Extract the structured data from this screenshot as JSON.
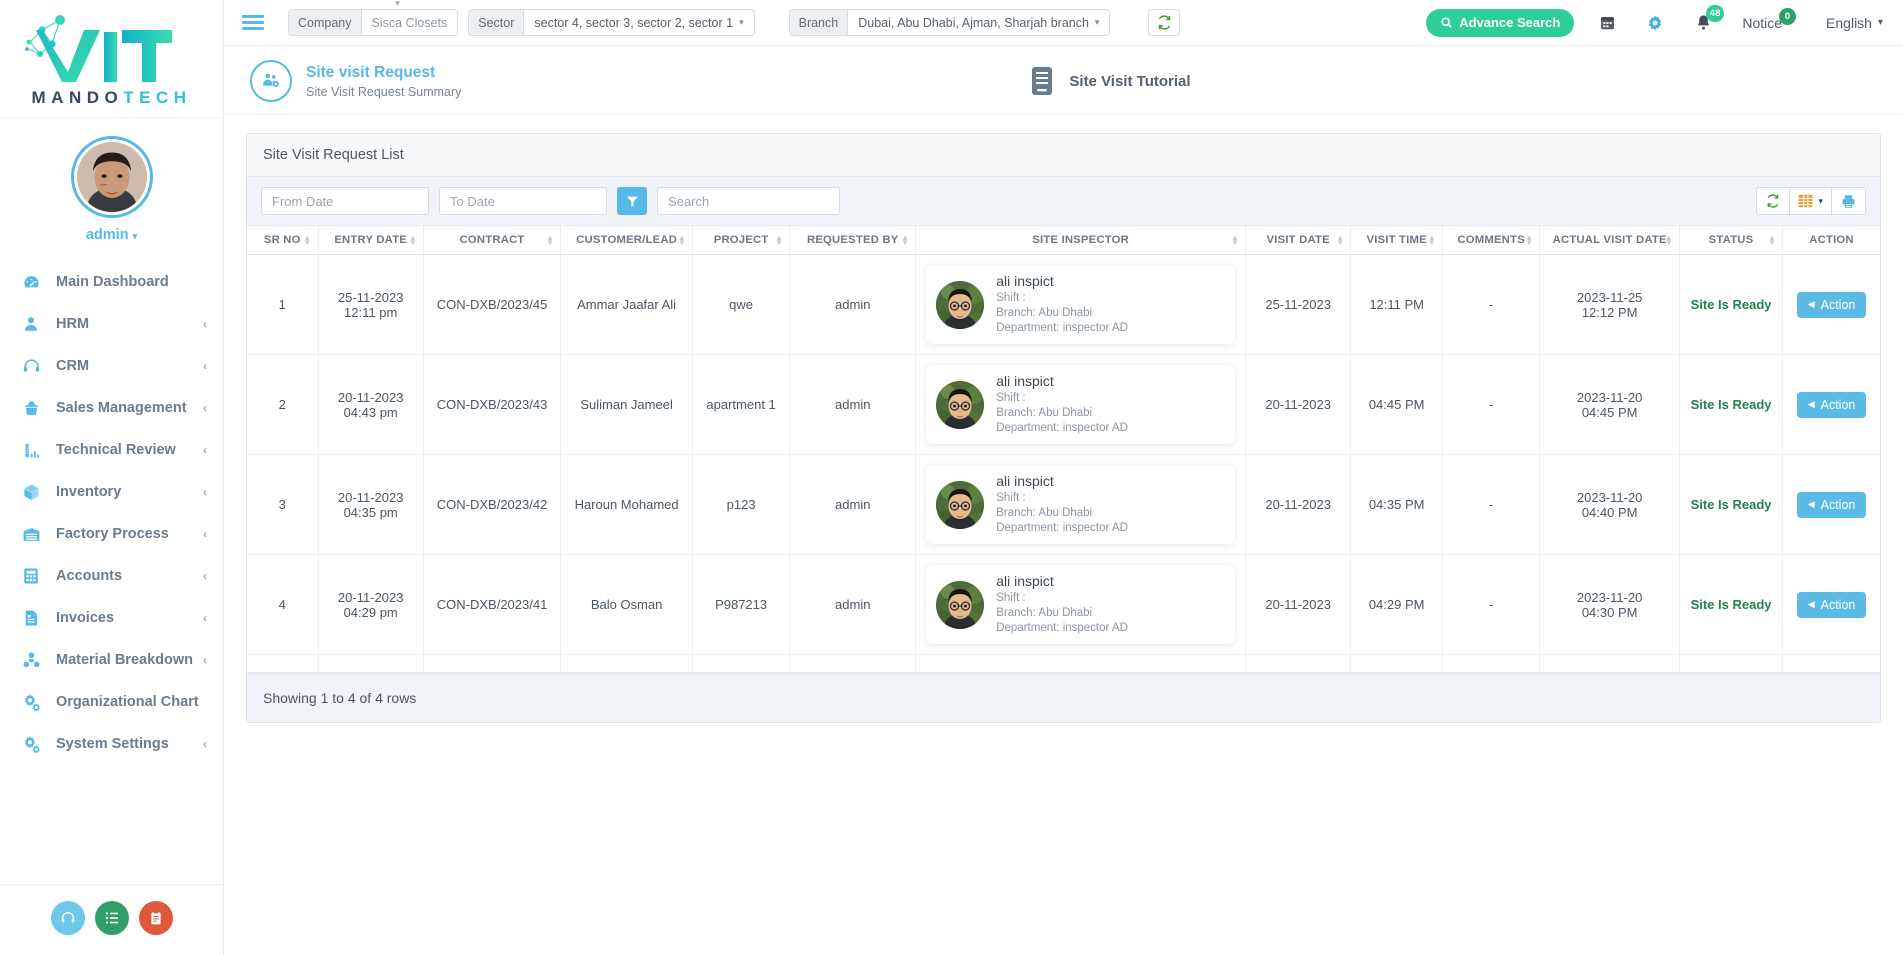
{
  "brand": {
    "word_a": "MANDO",
    "word_b": "TECH"
  },
  "profile": {
    "name": "admin",
    "caret": "▾"
  },
  "sidebar": {
    "items": [
      {
        "label": "Main Dashboard",
        "icon": "dashboard-icon",
        "chevron": ""
      },
      {
        "label": "HRM",
        "icon": "user-icon",
        "chevron": "‹"
      },
      {
        "label": "CRM",
        "icon": "headset-icon",
        "chevron": "‹"
      },
      {
        "label": "Sales Management",
        "icon": "basket-icon",
        "chevron": "‹"
      },
      {
        "label": "Technical Review",
        "icon": "ruler-icon",
        "chevron": "‹"
      },
      {
        "label": "Inventory",
        "icon": "box-icon",
        "chevron": "‹"
      },
      {
        "label": "Factory Process",
        "icon": "factory-icon",
        "chevron": "‹"
      },
      {
        "label": "Accounts",
        "icon": "calculator-icon",
        "chevron": "‹"
      },
      {
        "label": "Invoices",
        "icon": "invoice-icon",
        "chevron": "‹"
      },
      {
        "label": "Material Breakdown",
        "icon": "molecule-icon",
        "chevron": "‹"
      },
      {
        "label": "Organizational Chart",
        "icon": "gears-icon",
        "chevron": ""
      },
      {
        "label": "System Settings",
        "icon": "gears-icon",
        "chevron": "‹"
      }
    ],
    "fab": [
      {
        "name": "support-fab",
        "icon": "headset-icon",
        "color": "#6ec6e8"
      },
      {
        "name": "tasklist-fab",
        "icon": "list-icon",
        "color": "#2e9e6b"
      },
      {
        "name": "clipboard-fab",
        "icon": "clipboard-icon",
        "color": "#e0573e"
      }
    ]
  },
  "topbar": {
    "company_label": "Company",
    "company_value": "Sisca Closets",
    "sector_label": "Sector",
    "sector_value": "sector 4, sector 3, sector 2, sector 1",
    "branch_label": "Branch",
    "branch_value": "Dubai, Abu Dhabi, Ajman, Sharjah branch",
    "caret": "▾",
    "advance_search": "Advance Search",
    "alerts_count": "48",
    "notice_label": "Notice",
    "notice_count": "0",
    "language": "English",
    "lang_caret": "▾"
  },
  "page": {
    "title": "Site visit Request",
    "subtitle": "Site Visit Request Summary",
    "tutorial_label": "Site Visit Tutorial"
  },
  "list": {
    "card_title": "Site Visit Request List",
    "from_date_placeholder": "From Date",
    "to_date_placeholder": "To Date",
    "search_placeholder": "Search",
    "from_date_value": "",
    "to_date_value": "",
    "search_value": "",
    "footer": "Showing 1 to 4 of 4 rows",
    "columns": [
      "SR NO",
      "ENTRY DATE",
      "CONTRACT",
      "CUSTOMER/LEAD",
      "PROJECT",
      "REQUESTED BY",
      "SITE INSPECTOR",
      "VISIT DATE",
      "VISIT TIME",
      "COMMENTS",
      "ACTUAL VISIT DATE",
      "STATUS",
      "ACTION"
    ],
    "rows": [
      {
        "sr": "1",
        "entry_date": "25-11-2023",
        "entry_time": "12:11 pm",
        "contract": "CON-DXB/2023/45",
        "customer": "Ammar Jaafar Ali",
        "project": "qwe",
        "requested_by": "admin",
        "inspector_name": "ali inspict",
        "inspector_shift": "Shift :",
        "inspector_branch": "Branch: Abu Dhabi",
        "inspector_department": "Department: inspector AD",
        "visit_date": "25-11-2023",
        "visit_time": "12:11 PM",
        "comments": "-",
        "actual_visit_date": "2023-11-25",
        "actual_visit_time": "12:12 PM",
        "status": "Site Is Ready",
        "action": "Action"
      },
      {
        "sr": "2",
        "entry_date": "20-11-2023",
        "entry_time": "04:43 pm",
        "contract": "CON-DXB/2023/43",
        "customer": "Suliman Jameel",
        "project": "apartment 1",
        "requested_by": "admin",
        "inspector_name": "ali inspict",
        "inspector_shift": "Shift :",
        "inspector_branch": "Branch: Abu Dhabi",
        "inspector_department": "Department: inspector AD",
        "visit_date": "20-11-2023",
        "visit_time": "04:45 PM",
        "comments": "-",
        "actual_visit_date": "2023-11-20",
        "actual_visit_time": "04:45 PM",
        "status": "Site Is Ready",
        "action": "Action"
      },
      {
        "sr": "3",
        "entry_date": "20-11-2023",
        "entry_time": "04:35 pm",
        "contract": "CON-DXB/2023/42",
        "customer": "Haroun Mohamed",
        "project": "p123",
        "requested_by": "admin",
        "inspector_name": "ali inspict",
        "inspector_shift": "Shift :",
        "inspector_branch": "Branch: Abu Dhabi",
        "inspector_department": "Department: inspector AD",
        "visit_date": "20-11-2023",
        "visit_time": "04:35 PM",
        "comments": "-",
        "actual_visit_date": "2023-11-20",
        "actual_visit_time": "04:40 PM",
        "status": "Site Is Ready",
        "action": "Action"
      },
      {
        "sr": "4",
        "entry_date": "20-11-2023",
        "entry_time": "04:29 pm",
        "contract": "CON-DXB/2023/41",
        "customer": "Balo Osman",
        "project": "P987213",
        "requested_by": "admin",
        "inspector_name": "ali inspict",
        "inspector_shift": "Shift :",
        "inspector_branch": "Branch: Abu Dhabi",
        "inspector_department": "Department: inspector AD",
        "visit_date": "20-11-2023",
        "visit_time": "04:29 PM",
        "comments": "-",
        "actual_visit_date": "2023-11-20",
        "actual_visit_time": "04:30 PM",
        "status": "Site Is Ready",
        "action": "Action"
      }
    ]
  },
  "colors": {
    "accent_blue": "#56b9e9",
    "accent_green": "#2fce96",
    "status_green": "#1e8252",
    "action_blue": "#5bbbe5",
    "red": "#e0573e"
  }
}
